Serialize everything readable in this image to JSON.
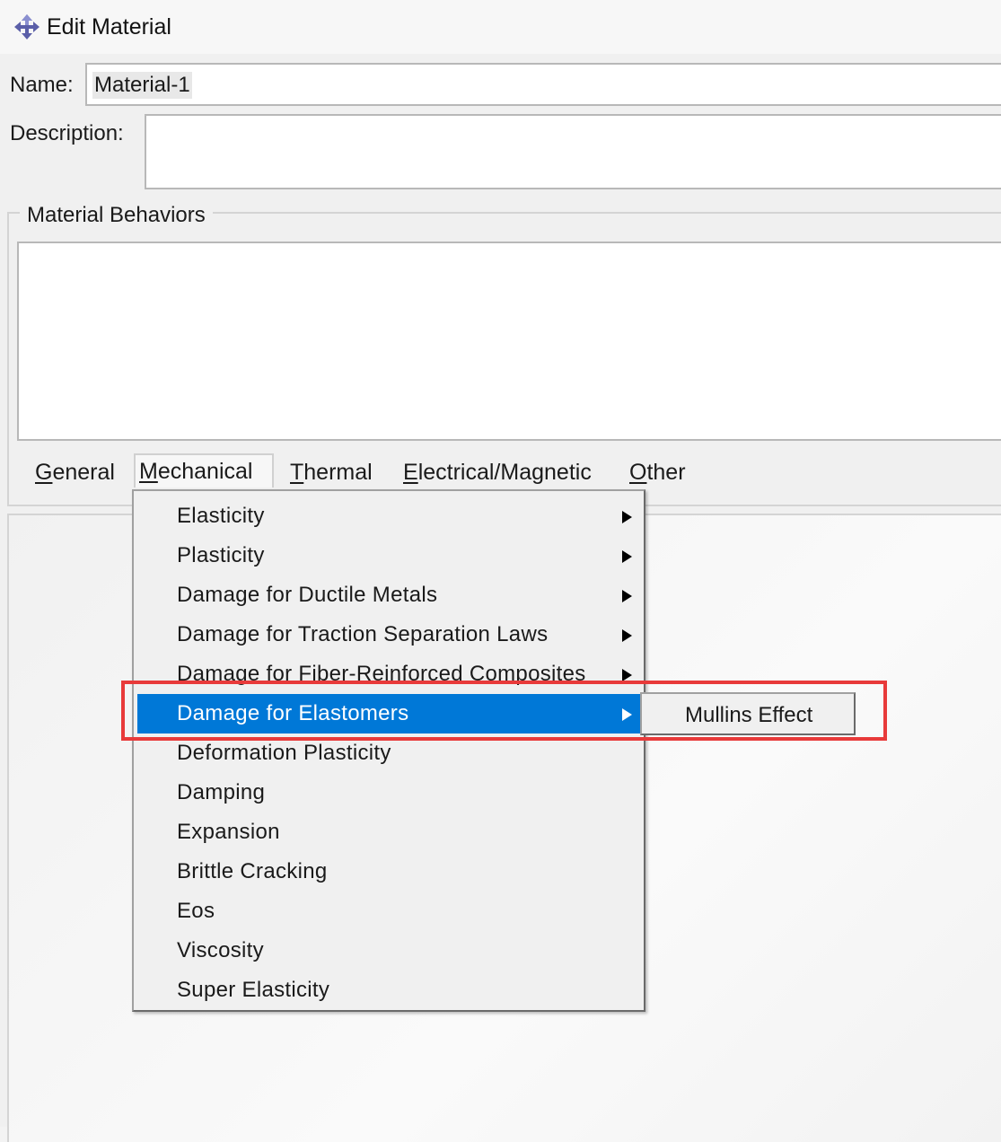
{
  "window": {
    "title": "Edit Material",
    "icon": "abaqus-material-icon"
  },
  "form": {
    "name_label": "Name:",
    "name_value": "Material-1",
    "description_label": "Description:",
    "description_value": ""
  },
  "behaviors": {
    "group_title": "Material Behaviors",
    "items": []
  },
  "menubar": {
    "items": [
      {
        "label": "General",
        "underline_index": 0
      },
      {
        "label": "Mechanical",
        "underline_index": 0
      },
      {
        "label": "Thermal",
        "underline_index": 0
      },
      {
        "label": "Electrical/Magnetic",
        "underline_index": 0
      },
      {
        "label": "Other",
        "underline_index": 0
      }
    ],
    "active": "Mechanical"
  },
  "mechanical_menu": {
    "items": [
      {
        "label": "Elasticity",
        "submenu": true
      },
      {
        "label": "Plasticity",
        "submenu": true
      },
      {
        "label": "Damage for Ductile Metals",
        "submenu": true
      },
      {
        "label": "Damage for Traction Separation Laws",
        "submenu": true
      },
      {
        "label": "Damage for Fiber-Reinforced Composites",
        "submenu": true
      },
      {
        "label": "Damage for Elastomers",
        "submenu": true,
        "highlighted": true
      },
      {
        "label": "Deformation Plasticity",
        "submenu": false
      },
      {
        "label": "Damping",
        "submenu": false
      },
      {
        "label": "Expansion",
        "submenu": false
      },
      {
        "label": "Brittle Cracking",
        "submenu": false
      },
      {
        "label": "Eos",
        "submenu": false
      },
      {
        "label": "Viscosity",
        "submenu": false
      },
      {
        "label": "Super Elasticity",
        "submenu": false
      }
    ]
  },
  "elastomer_submenu": {
    "items": [
      {
        "label": "Mullins Effect"
      }
    ]
  },
  "colors": {
    "highlight": "#0078d7",
    "annotation_box": "#e83a3a"
  }
}
